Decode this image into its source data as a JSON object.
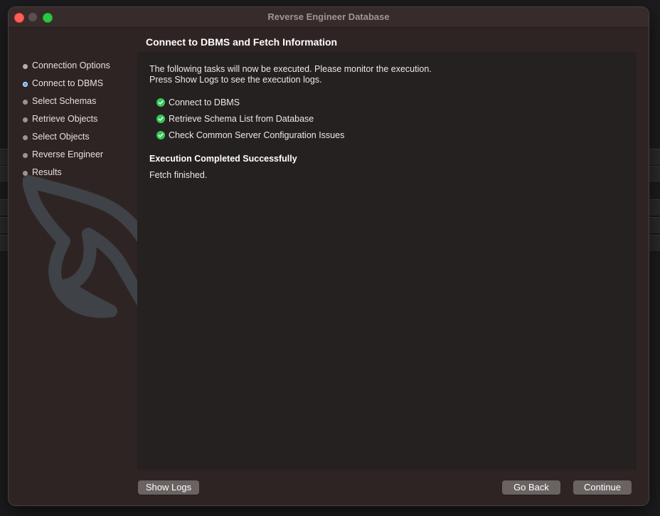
{
  "window": {
    "title": "Reverse Engineer Database"
  },
  "sidebar": {
    "steps": [
      {
        "label": "Connection Options",
        "state": "done"
      },
      {
        "label": "Connect to DBMS",
        "state": "active"
      },
      {
        "label": "Select Schemas",
        "state": "pending"
      },
      {
        "label": "Retrieve Objects",
        "state": "pending"
      },
      {
        "label": "Select Objects",
        "state": "pending"
      },
      {
        "label": "Reverse Engineer",
        "state": "pending"
      },
      {
        "label": "Results",
        "state": "pending"
      }
    ]
  },
  "main": {
    "title": "Connect to DBMS and Fetch Information",
    "intro_line1": "The following tasks will now be executed. Please monitor the execution.",
    "intro_line2": "Press Show Logs to see the execution logs.",
    "tasks": [
      {
        "label": "Connect to DBMS",
        "status": "completed"
      },
      {
        "label": "Retrieve Schema List from Database",
        "status": "completed"
      },
      {
        "label": "Check Common Server Configuration Issues",
        "status": "completed"
      }
    ],
    "status_title": "Execution Completed Successfully",
    "status_message": "Fetch finished."
  },
  "footer": {
    "show_logs_label": "Show Logs",
    "go_back_label": "Go Back",
    "continue_label": "Continue"
  },
  "colors": {
    "window_bg": "#2f2424",
    "content_bg": "#242120",
    "check_green": "#34c759",
    "active_step": "#5aa7ff"
  },
  "icons": {
    "task_status": "check-circle-icon",
    "watermark": "dolphin-logo"
  }
}
